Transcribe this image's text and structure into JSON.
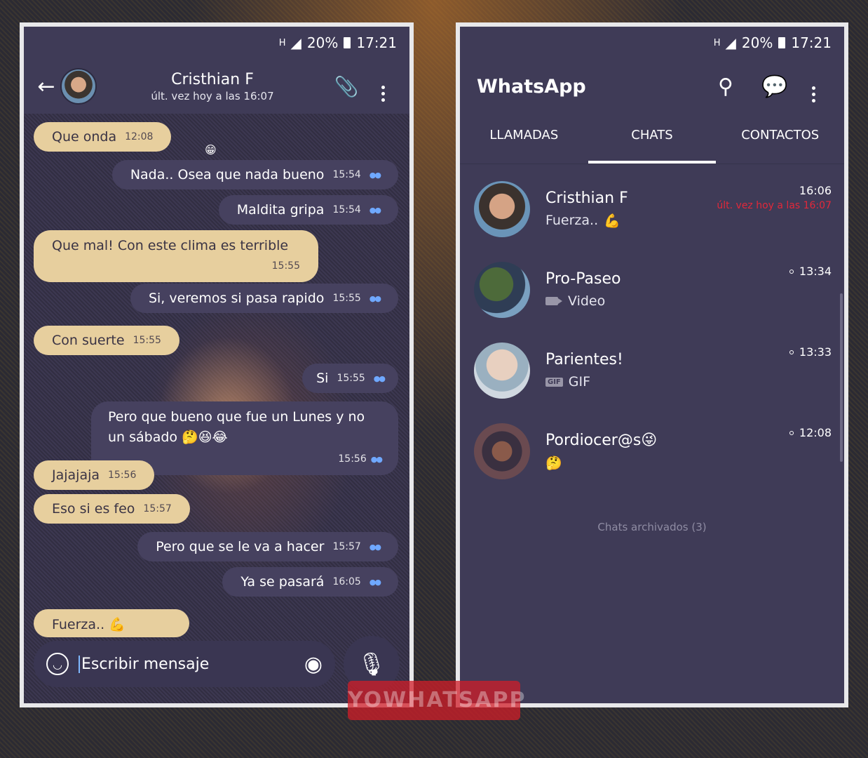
{
  "status_bar": {
    "network": "H",
    "battery": "20%",
    "time": "17:21"
  },
  "chat": {
    "contact_name": "Cristhian F",
    "last_seen": "últ. vez hoy a las 16:07",
    "floating_emoji": "😁",
    "messages": [
      {
        "direction": "in",
        "text": "Que onda",
        "time": "12:08"
      },
      {
        "direction": "out",
        "text": "Nada..  Osea que nada bueno",
        "time": "15:54"
      },
      {
        "direction": "out",
        "text": "Maldita gripa",
        "time": "15:54"
      },
      {
        "direction": "in",
        "text": "Que mal!  Con este clima es terrible",
        "time": "15:55"
      },
      {
        "direction": "out",
        "text": "Si, veremos si pasa rapido",
        "time": "15:55"
      },
      {
        "direction": "in",
        "text": "Con suerte",
        "time": "15:55"
      },
      {
        "direction": "out",
        "text": "Si",
        "time": "15:55"
      },
      {
        "direction": "out",
        "text": "Pero que bueno que fue un Lunes y no un sábado 🤔😆😂",
        "time": "15:56"
      },
      {
        "direction": "in",
        "text": "Jajajaja",
        "time": "15:56"
      },
      {
        "direction": "in",
        "text": "Eso si es feo",
        "time": "15:57"
      },
      {
        "direction": "out",
        "text": "Pero que se le va a hacer",
        "time": "15:57"
      },
      {
        "direction": "out",
        "text": "Ya se pasará",
        "time": "16:05"
      },
      {
        "direction": "in",
        "text": "Fuerza.. 💪",
        "time": ""
      }
    ],
    "composer_placeholder": "Escribir mensaje"
  },
  "list": {
    "app_title": "WhatsApp",
    "tabs": [
      {
        "label": "LLAMADAS",
        "active": false
      },
      {
        "label": "CHATS",
        "active": true
      },
      {
        "label": "CONTACTOS",
        "active": false
      }
    ],
    "chats": [
      {
        "name": "Cristhian F",
        "preview": "Fuerza..",
        "preview_emoji": "💪",
        "time": "16:06",
        "status": "últ. vez hoy a las 16:07"
      },
      {
        "name": "Pro-Paseo",
        "preview": "Video",
        "preview_icon": "video-icon",
        "time": "13:34"
      },
      {
        "name": "Parientes!",
        "preview": "GIF",
        "preview_icon": "gif-icon",
        "gif_badge": "GIF",
        "time": "13:33"
      },
      {
        "name": "Pordiocer@s😜",
        "preview": "🤔",
        "time": "12:08"
      }
    ],
    "archived": "Chats archivados (3)"
  },
  "watermark": "YOWHATSAPP",
  "colors": {
    "screen_bg": "#3f3b57",
    "incoming_bubble": "#e7cf9e",
    "outgoing_bubble": "#46415f",
    "ticks": "#6fa8ff",
    "status_red": "#e2283a"
  }
}
